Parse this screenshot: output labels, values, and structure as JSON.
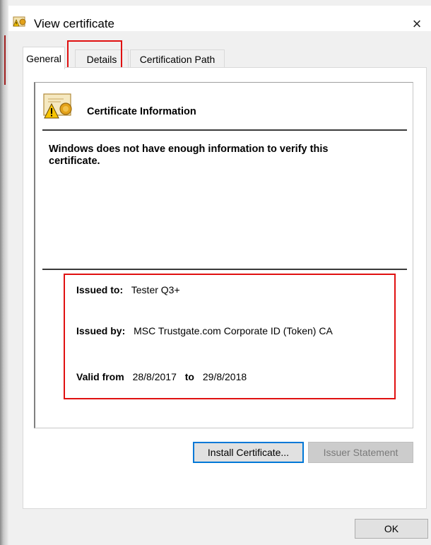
{
  "window": {
    "title": "View certificate",
    "close_glyph": "×",
    "icon": "certificate-warning-icon"
  },
  "tabs": [
    {
      "label": "General",
      "active": true
    },
    {
      "label": "Details",
      "active": false
    },
    {
      "label": "Certification Path",
      "active": false
    }
  ],
  "general": {
    "section_title": "Certificate Information",
    "warning_text": "Windows does not have enough information to verify this certificate.",
    "issued_to_label": "Issued to:",
    "issued_to_value": "Tester Q3+",
    "issued_by_label": "Issued by:",
    "issued_by_value": "MSC Trustgate.com Corporate ID (Token) CA",
    "valid_from_label": "Valid from",
    "valid_from_value": "28/8/2017",
    "valid_to_label": "to",
    "valid_to_value": "29/8/2018"
  },
  "buttons": {
    "install": "Install Certificate...",
    "issuer_statement": "Issuer Statement",
    "ok": "OK"
  },
  "colors": {
    "highlight": "#e01010",
    "focus_border": "#0078d7",
    "disabled_text": "#7a7a7a"
  }
}
